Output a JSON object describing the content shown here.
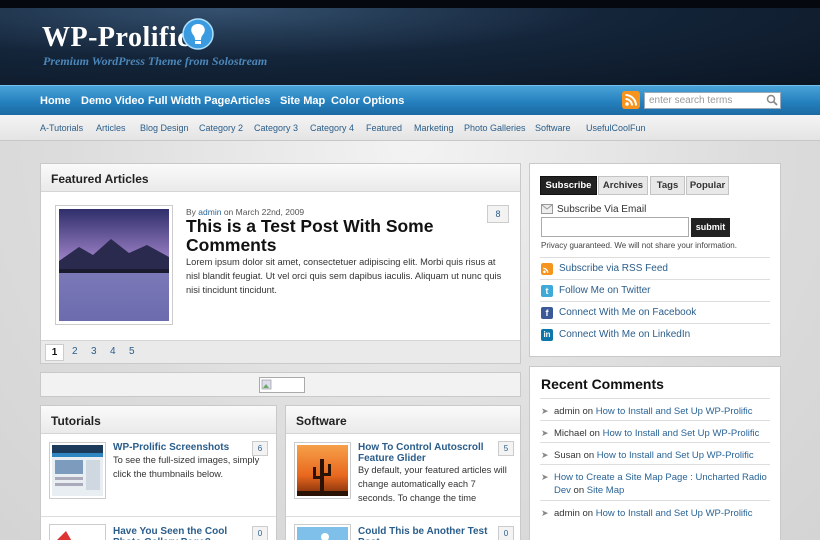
{
  "site": {
    "title": "WP-Prolific",
    "tagline": "Premium WordPress Theme from Solostream"
  },
  "nav": {
    "items": [
      "Home",
      "Demo Video",
      "Full Width Page",
      "Articles",
      "Site Map",
      "Color Options"
    ],
    "search_placeholder": "enter search terms"
  },
  "subnav": {
    "items": [
      "A-Tutorials",
      "Articles",
      "Blog Design",
      "Category 2",
      "Category 3",
      "Category 4",
      "Featured",
      "Marketing",
      "Photo Galleries",
      "Software",
      "UsefulCoolFun"
    ]
  },
  "featured": {
    "heading": "Featured Articles",
    "by_prefix": "By",
    "author": "admin",
    "date_text": "on March 22nd, 2009",
    "title": "This is a Test Post With Some Comments",
    "excerpt": "Lorem ipsum dolor sit amet, consectetuer adipiscing elit. Morbi quis risus at nisl blandit feugiat. Ut vel orci quis sem dapibus iaculis. Aliquam ut nunc quis nisi tincidunt tincidunt.",
    "comment_count": "8",
    "pages": [
      "1",
      "2",
      "3",
      "4",
      "5"
    ]
  },
  "tutorials": {
    "heading": "Tutorials",
    "posts": [
      {
        "title": "WP-Prolific Screenshots",
        "excerpt": "To see the full-sized images, simply click the thumbnails below.",
        "count": "6"
      },
      {
        "title": "Have You Seen the Cool Photo Gallery Page?",
        "count": "0"
      }
    ]
  },
  "software": {
    "heading": "Software",
    "posts": [
      {
        "title": "How To Control Autoscroll Feature Glider",
        "excerpt": "By default, your featured articles will change automatically each 7 seconds. To change the time",
        "count": "5"
      },
      {
        "title": "Could This be Another Test Post",
        "count": "0"
      }
    ]
  },
  "sidebar": {
    "tabs": [
      "Subscribe",
      "Archives",
      "Tags",
      "Popular"
    ],
    "email_label": "Subscribe Via Email",
    "submit_label": "submit",
    "privacy": "Privacy guaranteed. We will not share your information.",
    "links": [
      "Subscribe via RSS Feed",
      "Follow Me on Twitter",
      "Connect With Me on Facebook",
      "Connect With Me on LinkedIn"
    ]
  },
  "recent_comments": {
    "heading": "Recent Comments",
    "items": [
      {
        "author": "admin",
        "on": "on",
        "post": "How to Install and Set Up WP-Prolific"
      },
      {
        "author": "Michael",
        "on": "on",
        "post": "How to Install and Set Up WP-Prolific"
      },
      {
        "author": "Susan",
        "on": "on",
        "post": "How to Install and Set Up WP-Prolific"
      },
      {
        "author": "How to Create a Site Map Page : Uncharted Radio Dev",
        "on": "on",
        "post": "Site Map"
      },
      {
        "author": "admin",
        "on": "on",
        "post": "How to Install and Set Up WP-Prolific"
      }
    ]
  },
  "colors": {
    "nav_blue": "#2580be",
    "link_blue": "#2a5d8a",
    "header_dark": "#14253a",
    "logo_bulb": "#3b9be0"
  },
  "icons": [
    "lightbulb-logo-icon",
    "rss-icon",
    "search-icon",
    "email-icon",
    "twitter-icon",
    "facebook-icon",
    "linkedin-icon",
    "arrow-icon"
  ]
}
